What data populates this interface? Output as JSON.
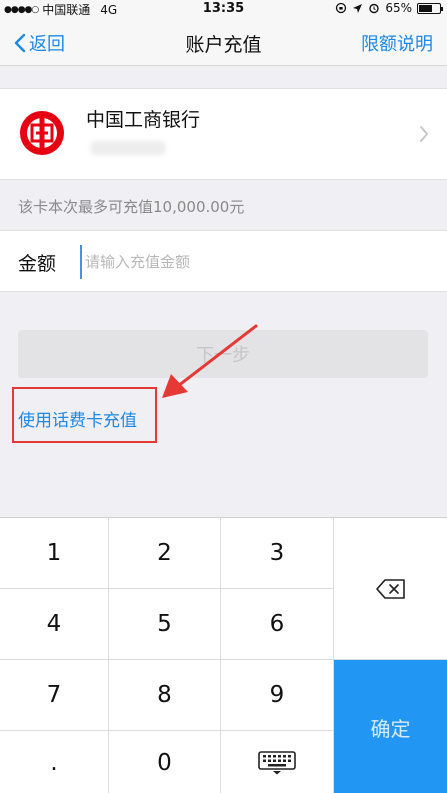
{
  "status_bar": {
    "carrier": "中国联通",
    "network": "4G",
    "time": "13:35",
    "battery": "65%",
    "battery_level": 0.65
  },
  "nav": {
    "back_label": "返回",
    "title": "账户充值",
    "right_label": "限额说明"
  },
  "bank": {
    "name": "中国工商银行",
    "logo_color": "#e60012"
  },
  "limit_text": "该卡本次最多可充值10,000.00元",
  "amount": {
    "label": "金额",
    "placeholder": "请输入充值金额",
    "value": ""
  },
  "next_button": "下一步",
  "phonecard_link": "使用话费卡充值",
  "keypad": {
    "keys": [
      "1",
      "2",
      "3",
      "4",
      "5",
      "6",
      "7",
      "8",
      "9",
      ".",
      "0"
    ],
    "confirm": "确定",
    "confirm_color": "#2196f3"
  },
  "accent_color": "#1e88e5",
  "annotation_color": "#e53935"
}
